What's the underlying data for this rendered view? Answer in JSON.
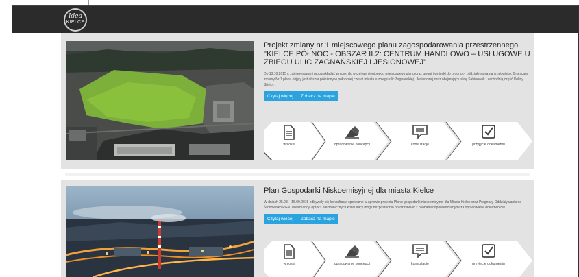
{
  "header": {
    "logo_line1": "Idea",
    "logo_line2": "KIELCE"
  },
  "projects": [
    {
      "title": "Projekt zmiany nr 1 miejscowego planu zagospodarowania przestrzennego \"KIELCE PÓŁNOC - OBSZAR II.2: CENTRUM HANDLOWO – USŁUGOWE U ZBIEGU ULIC ZAGNAŃSKIEJ I JESIONOWEJ\"",
      "description": "Do 13.10.2015 r. zainteresowani mogą składać wnioski do wyżej wymienionego miejscowego planu oraz uwagi i wnioski do prognozy oddziaływania na środowisko. Granicami zmiany Nr 1 planu objęty jest obszar położony w północnej części miasta u zbiegu ulic Zagnańskiej i Jesionowej oraz obejmujący ulicę Sabinówek i zachodnią część Doliny Silnicy.",
      "read_more": "Czytaj więcej",
      "view_map": "Zobacz na mapie"
    },
    {
      "title": "Plan Gospodarki Niskoemisyjnej dla miasta Kielce",
      "description": "W dniach 25.08 – 15.09.2015 odbywały się konsultacje społeczne w sprawie projektu Planu gospodarki niskoemisyjnej dla Miasta Kielce oraz Prognozy Oddziaływania na Środowisko PGN. Mieszkańcy, oprócz elektronicznych konsultacji mogli bezpośrednio porozmawiać z osobami odpowiedzialnymi za opracowanie dokumentów.",
      "read_more": "Czytaj więcej",
      "view_map": "Zobacz na mapie"
    }
  ],
  "steps": [
    {
      "label": "wnioski",
      "icon": "document-icon"
    },
    {
      "label": "opracowanie koncepcji",
      "icon": "pen-icon"
    },
    {
      "label": "konsultacje",
      "icon": "speech-bubble-icon"
    },
    {
      "label": "przyjęcie dokumentu",
      "icon": "checkbox-icon"
    }
  ]
}
